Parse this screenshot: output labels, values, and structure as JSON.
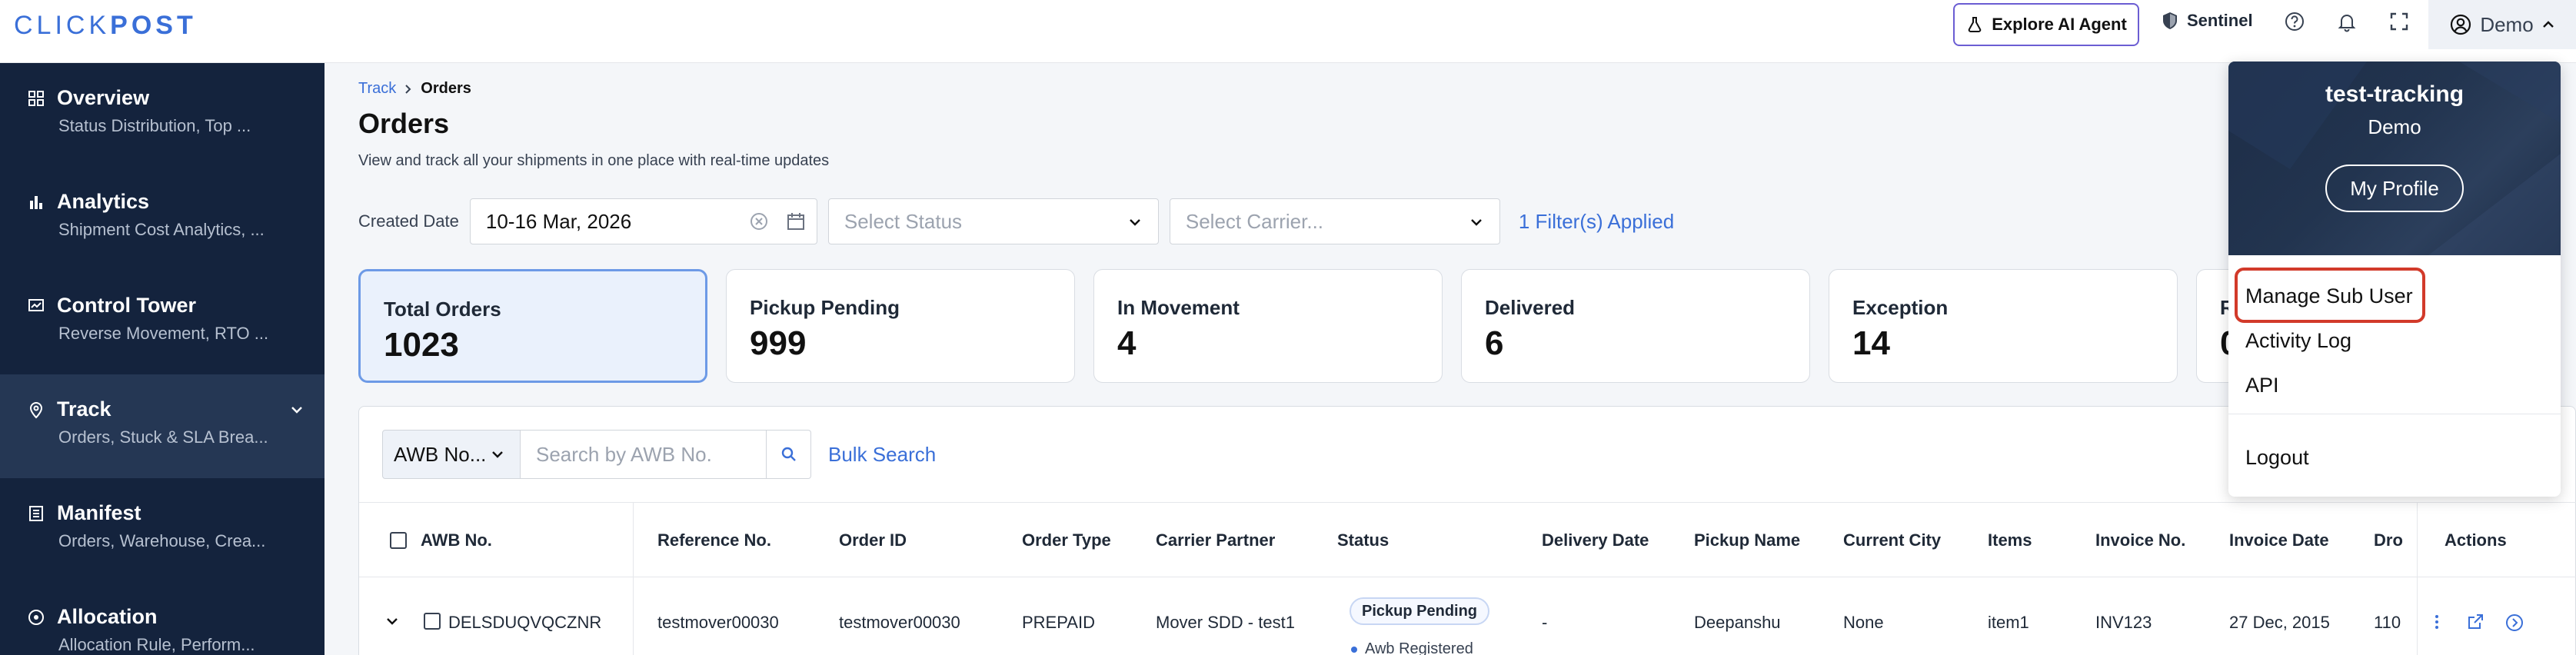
{
  "app": {
    "logo_left": "CLICK",
    "logo_right": "POST"
  },
  "topbar": {
    "explore_label": "Explore AI Agent",
    "sentinel_label": "Sentinel",
    "user_label": "Demo"
  },
  "sidebar": {
    "items": [
      {
        "title": "Overview",
        "subtitle": "Status Distribution, Top ..."
      },
      {
        "title": "Analytics",
        "subtitle": "Shipment Cost Analytics, ..."
      },
      {
        "title": "Control Tower",
        "subtitle": "Reverse Movement, RTO ..."
      },
      {
        "title": "Track",
        "subtitle": "Orders, Stuck & SLA Brea..."
      },
      {
        "title": "Manifest",
        "subtitle": "Orders, Warehouse, Crea..."
      },
      {
        "title": "Allocation",
        "subtitle": "Allocation Rule, Perform..."
      }
    ]
  },
  "breadcrumb": {
    "parent": "Track",
    "current": "Orders"
  },
  "page": {
    "title": "Orders",
    "description": "View and track all your shipments in one place with real-time updates"
  },
  "filters": {
    "created_date_label": "Created Date",
    "date_value": "10-16 Mar, 2026",
    "status_placeholder": "Select Status",
    "carrier_placeholder": "Select Carrier...",
    "applied_label": "1 Filter(s) Applied"
  },
  "cards": [
    {
      "label": "Total Orders",
      "value": "1023"
    },
    {
      "label": "Pickup Pending",
      "value": "999"
    },
    {
      "label": "In Movement",
      "value": "4"
    },
    {
      "label": "Delivered",
      "value": "6"
    },
    {
      "label": "Exception",
      "value": "14"
    },
    {
      "label": "R",
      "value": "0"
    }
  ],
  "search": {
    "dropdown_label": "AWB No...",
    "placeholder": "Search by AWB No.",
    "bulk_label": "Bulk Search"
  },
  "table": {
    "columns": [
      "AWB No.",
      "Reference No.",
      "Order ID",
      "Order Type",
      "Carrier Partner",
      "Status",
      "Delivery Date",
      "Pickup Name",
      "Current City",
      "Items",
      "Invoice No.",
      "Invoice Date",
      "Dro",
      "Actions"
    ],
    "rows": [
      {
        "awb": "DELSDUQVQCZNR",
        "reference": "testmover00030",
        "order_id": "testmover00030",
        "order_type": "PREPAID",
        "carrier": "Mover SDD - test1",
        "status": "Pickup Pending",
        "sub_status": "Awb Registered",
        "delivery_date": "-",
        "pickup_name": "Deepanshu",
        "current_city": "None",
        "items": "item1",
        "invoice_no": "INV123",
        "invoice_date": "27 Dec, 2015",
        "drop": "110"
      }
    ]
  },
  "profile_menu": {
    "org": "test-tracking",
    "user": "Demo",
    "my_profile": "My Profile",
    "items": [
      "Manage Sub User",
      "Activity Log",
      "API"
    ],
    "logout": "Logout"
  },
  "colors": {
    "accent": "#3a6fd8",
    "sidebar_bg": "#14233d",
    "sidebar_active": "#253754",
    "highlight_red": "#d23a2a"
  }
}
